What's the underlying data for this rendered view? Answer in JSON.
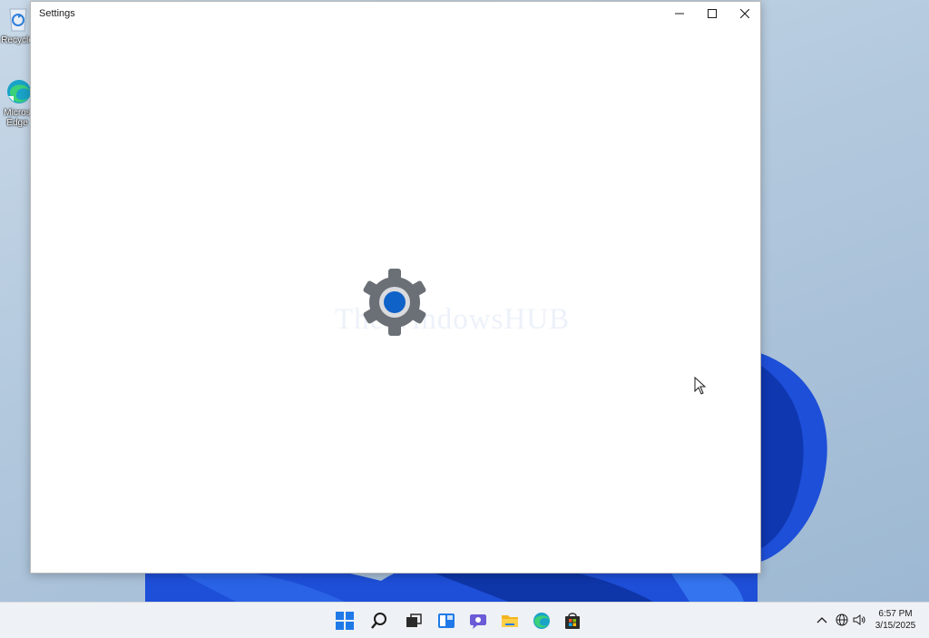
{
  "window": {
    "title": "Settings",
    "controls": {
      "minimize": "minimize",
      "maximize": "maximize",
      "close": "close"
    },
    "splash_icon": "gear-icon",
    "watermark": "TheWindowsHUB"
  },
  "desktop": {
    "icons": [
      {
        "label": "Recycle",
        "icon": "recycle-bin-icon"
      },
      {
        "label": "Micros Edge",
        "icon": "edge-icon"
      }
    ]
  },
  "taskbar": {
    "apps": [
      "start-icon",
      "search-icon",
      "task-view-icon",
      "widgets-icon",
      "chat-icon",
      "file-explorer-icon",
      "edge-icon",
      "store-icon"
    ],
    "tray": [
      "chevron-up-icon",
      "network-icon",
      "volume-icon"
    ],
    "clock": {
      "time": "6:57 PM",
      "date": "3/15/2025"
    }
  },
  "colors": {
    "accent": "#0f62c8",
    "gear": "#6b6f76",
    "desktop": "#b2c8dd",
    "bloom": "#1546c9",
    "taskbar": "#eef1f5"
  }
}
